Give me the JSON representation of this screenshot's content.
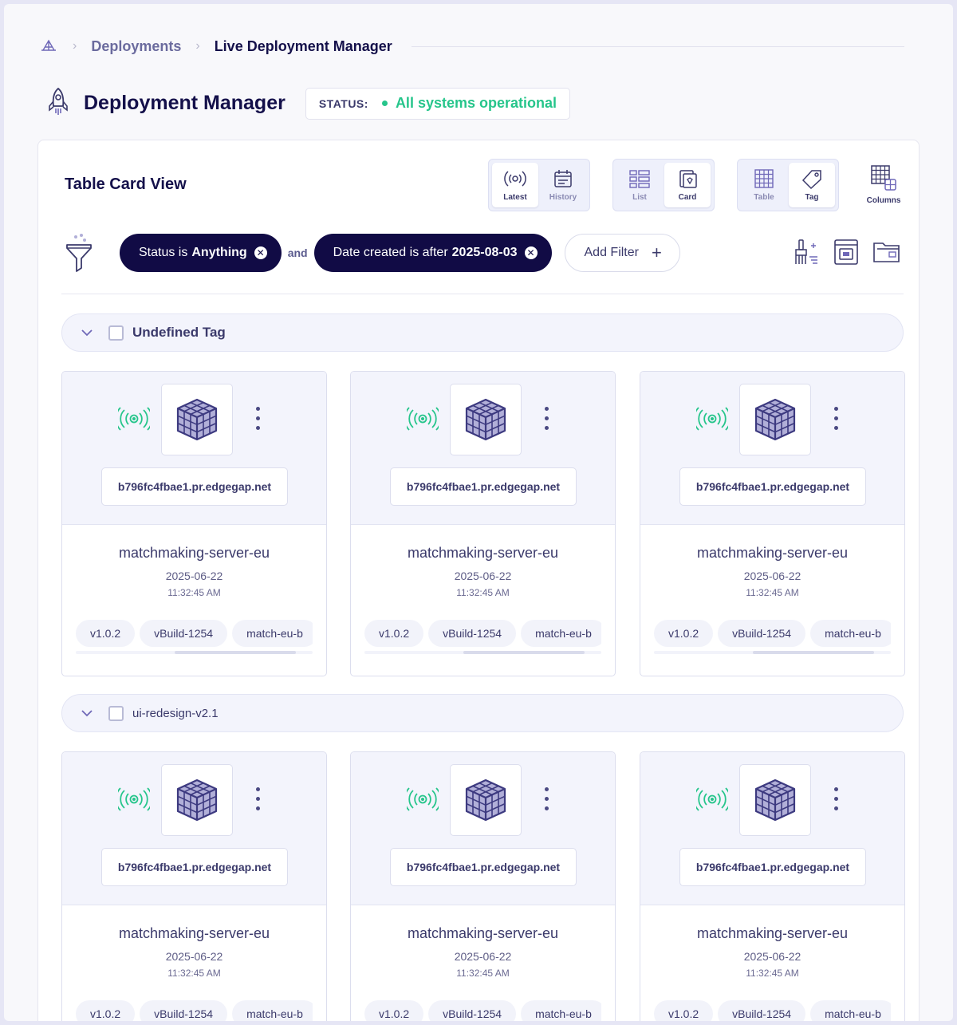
{
  "breadcrumb": {
    "home_icon": "sail-logo-icon",
    "items": [
      "Deployments",
      "Live Deployment Manager"
    ]
  },
  "header": {
    "title": "Deployment Manager",
    "icon": "rocket-icon",
    "status_label": "STATUS:",
    "status_value": "All systems operational",
    "status_color": "#26c58b"
  },
  "panel": {
    "title": "Table Card View",
    "toggles": {
      "time": [
        {
          "label": "Latest",
          "icon": "broadcast-icon",
          "active": true
        },
        {
          "label": "History",
          "icon": "calendar-icon",
          "active": false
        }
      ],
      "layout": [
        {
          "label": "List",
          "icon": "list-icon",
          "active": false
        },
        {
          "label": "Card",
          "icon": "card-icon",
          "active": true
        }
      ],
      "group": [
        {
          "label": "Table",
          "icon": "grid-icon",
          "active": false
        },
        {
          "label": "Tag",
          "icon": "tag-icon",
          "active": true
        }
      ]
    },
    "columns_label": "Columns"
  },
  "filters": {
    "chip1_prefix": "Status is",
    "chip1_value": "Anything",
    "joiner": "and",
    "chip2_prefix": "Date created is after",
    "chip2_value": "2025-08-03",
    "add_label": "Add Filter"
  },
  "groups": [
    {
      "name": "Undefined Tag"
    },
    {
      "name": "ui-redesign-v2.1"
    }
  ],
  "card": {
    "host": "b796fc4fbae1.pr.edgegap.net",
    "name": "matchmaking-server-eu",
    "date": "2025-06-22",
    "time": "11:32:45 AM",
    "tags": [
      "v1.0.2",
      "vBuild-1254",
      "match-eu-b"
    ]
  },
  "colors": {
    "brand_dark": "#110b45",
    "accent_green": "#26c58b",
    "accent_purple": "#6f68b8"
  }
}
